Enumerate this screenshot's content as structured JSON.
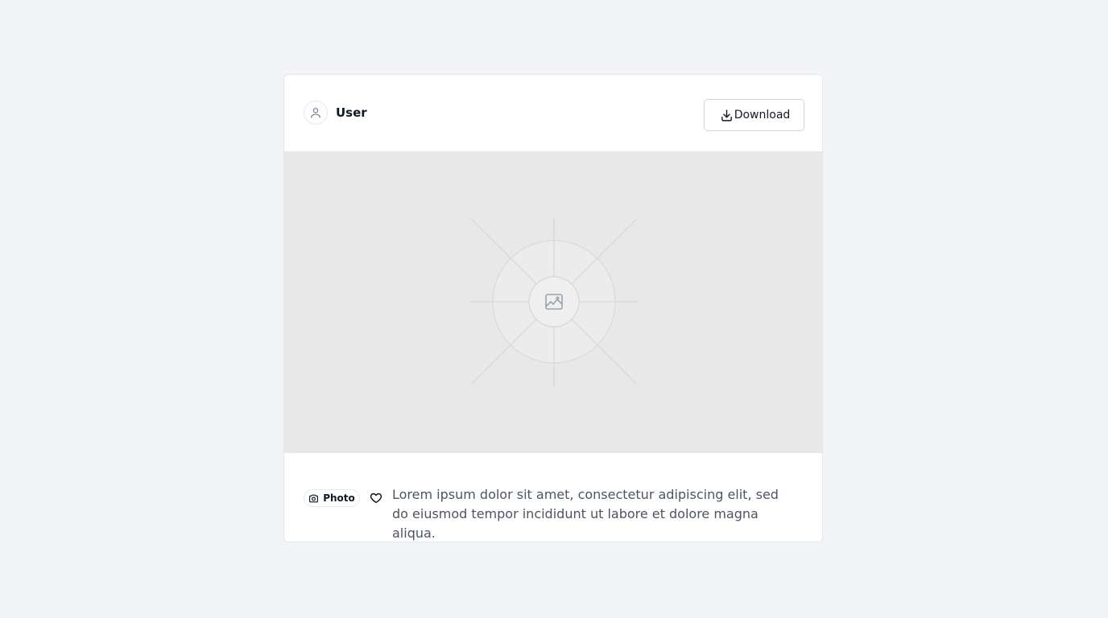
{
  "post": {
    "username": "User",
    "download_label": "Download",
    "media_icon": "image-icon",
    "badge_label": "Photo",
    "badge_icon": "camera-icon",
    "like_icon": "heart-icon",
    "caption": "Lorem ipsum dolor sit amet, consectetur adipiscing elit, sed do eiusmod tempor incididunt ut labore et dolore magna aliqua."
  }
}
